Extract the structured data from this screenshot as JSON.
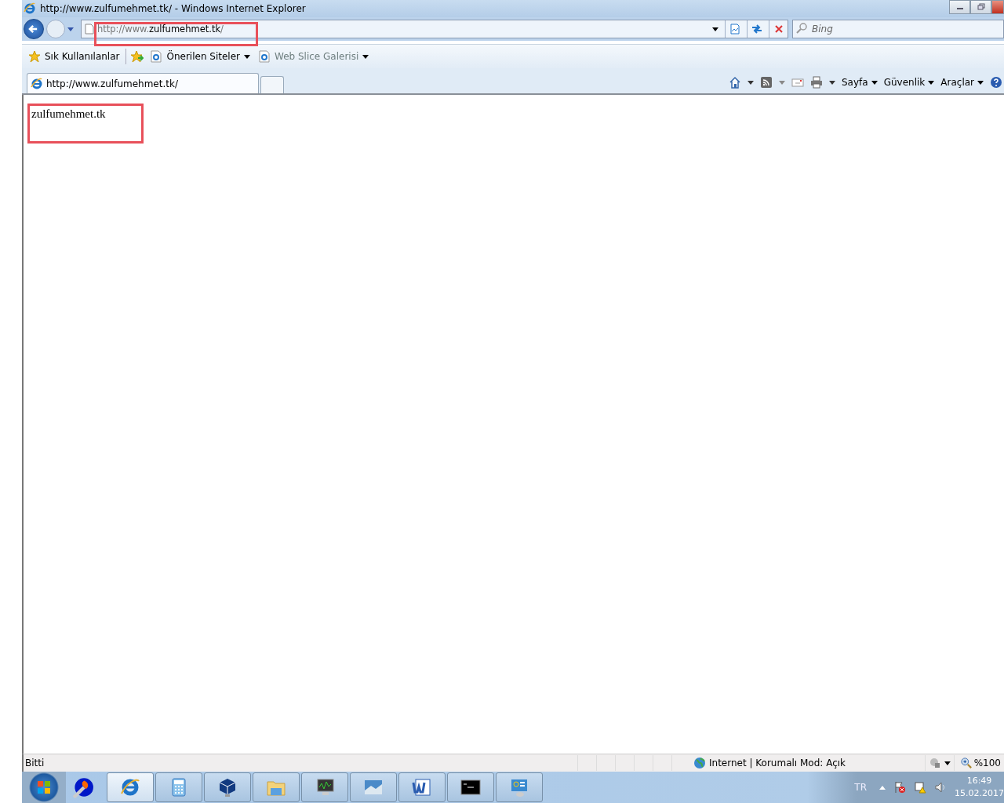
{
  "window": {
    "title": "http://www.zulfumehmet.tk/ - Windows Internet Explorer"
  },
  "address_bar": {
    "scheme": "http://www.",
    "domain": "zulfumehmet.tk",
    "path": "/"
  },
  "search": {
    "placeholder": "Bing"
  },
  "favorites_bar": {
    "label": "Sık Kullanılanlar",
    "items": [
      {
        "label": "Önerilen Siteler",
        "disabled": false
      },
      {
        "label": "Web Slice Galerisi",
        "disabled": true
      }
    ]
  },
  "tabs": [
    {
      "label": "http://www.zulfumehmet.tk/",
      "selected": true
    }
  ],
  "command_bar": {
    "menus": [
      "Sayfa",
      "Güvenlik",
      "Araçlar"
    ]
  },
  "page": {
    "text": "zulfumehmet.tk"
  },
  "status_bar": {
    "status": "Bitti",
    "zone": "Internet | Korumalı Mod: Açık",
    "zoom": "%100"
  },
  "taskbar": {
    "apps": [
      {
        "kind": "ie",
        "selected": true
      },
      {
        "kind": "calculator",
        "selected": false
      },
      {
        "kind": "cube",
        "selected": false
      },
      {
        "kind": "folder",
        "selected": false
      },
      {
        "kind": "monitor",
        "selected": false
      },
      {
        "kind": "picture",
        "selected": false
      },
      {
        "kind": "word",
        "selected": false
      },
      {
        "kind": "console",
        "selected": false
      },
      {
        "kind": "panel",
        "selected": false
      }
    ],
    "language": "TR",
    "time": "16:49",
    "date": "15.02.2017"
  }
}
